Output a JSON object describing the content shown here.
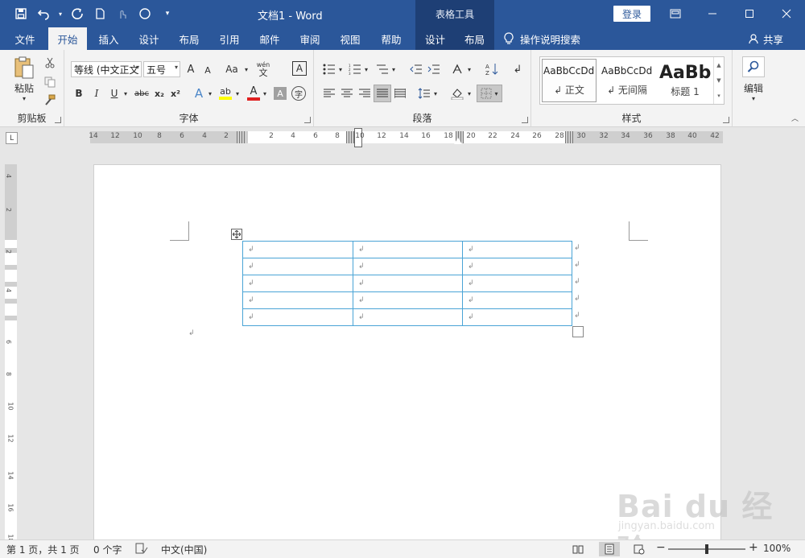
{
  "titlebar": {
    "title": "文档1  -  Word",
    "contextual_header": "表格工具",
    "login_label": "登录",
    "qat": [
      "save-icon",
      "undo-icon",
      "redo-icon",
      "new-doc-icon",
      "touch-mode-icon",
      "circle-icon",
      "customize-qat-icon"
    ]
  },
  "tabs": [
    {
      "label": "文件"
    },
    {
      "label": "开始"
    },
    {
      "label": "插入"
    },
    {
      "label": "设计"
    },
    {
      "label": "布局"
    },
    {
      "label": "引用"
    },
    {
      "label": "邮件"
    },
    {
      "label": "审阅"
    },
    {
      "label": "视图"
    },
    {
      "label": "帮助"
    },
    {
      "label": "设计"
    },
    {
      "label": "布局"
    }
  ],
  "tell_me": "操作说明搜索",
  "share": "共享",
  "ribbon": {
    "clipboard": {
      "paste": "粘贴",
      "group": "剪贴板"
    },
    "font": {
      "font_name": "等线 (中文正文",
      "font_size": "五号",
      "grow": "A",
      "shrink": "A",
      "change_case": "Aa",
      "phonetic_top": "wén",
      "phonetic_bottom": "文",
      "border_char": "A",
      "bold": "B",
      "italic": "I",
      "underline": "U",
      "strike": "abc",
      "subscript": "x₂",
      "superscript": "x²",
      "text_effect": "A",
      "highlight": "ab",
      "font_color": "A",
      "char_shading": "A",
      "enclose": "字",
      "group": "字体"
    },
    "paragraph": {
      "group": "段落"
    },
    "styles": {
      "items": [
        {
          "preview": "AaBbCcDd",
          "name": "↲ 正文"
        },
        {
          "preview": "AaBbCcDd",
          "name": "↲ 无间隔"
        },
        {
          "preview": "AaBb",
          "name": "标题 1"
        }
      ],
      "group": "样式"
    },
    "editing": {
      "label": "编辑"
    }
  },
  "ruler": {
    "h_numbers": [
      "14",
      "12",
      "10",
      "8",
      "6",
      "4",
      "2",
      "",
      "2",
      "4",
      "6",
      "8",
      "10",
      "12",
      "14",
      "16",
      "18",
      "20",
      "22",
      "24",
      "26",
      "28",
      "",
      "30",
      "32",
      "34",
      "36",
      "38",
      "40",
      "42"
    ],
    "v_numbers": [
      "4",
      "2",
      "",
      "2",
      "4",
      "6",
      "8",
      "10",
      "12",
      "14",
      "16",
      "18"
    ]
  },
  "table": {
    "rows": [
      [
        "↲",
        "↲",
        "↲"
      ],
      [
        "↲",
        "↲",
        "↲"
      ],
      [
        "↲",
        "↲",
        "↲"
      ],
      [
        "↲",
        "↲",
        "↲"
      ],
      [
        "↲",
        "↲",
        "↲"
      ]
    ],
    "row_end_mark": "↲",
    "paragraph_mark": "↲"
  },
  "statusbar": {
    "page": "第 1 页，共 1 页",
    "words": "0 个字",
    "language": "中文(中国)",
    "zoom_minus": "−",
    "zoom_plus": "+",
    "zoom": "100%"
  },
  "watermark": {
    "big": "Bai du 经验",
    "small": "jingyan.baidu.com"
  },
  "colors": {
    "brand": "#2b579a",
    "contextual": "#1e3f75",
    "table_border": "#4aa4d6"
  }
}
